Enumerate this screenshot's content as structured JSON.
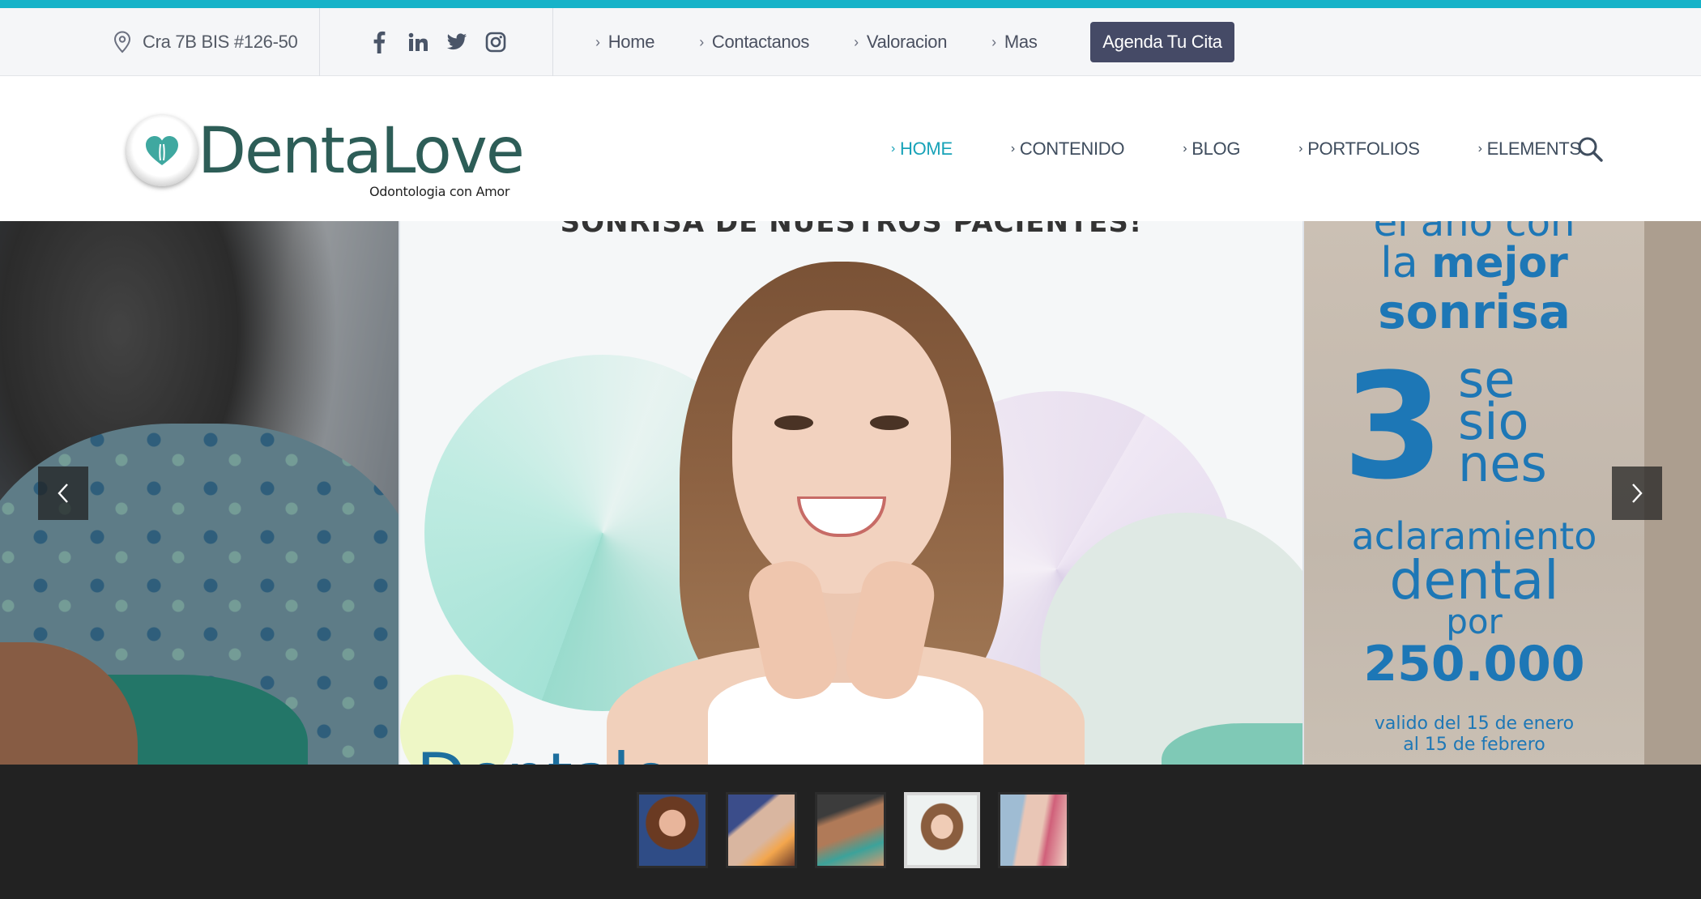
{
  "colors": {
    "accent": "#17a2b8",
    "cta_bg": "#454a66",
    "logo_green": "#2d5d57",
    "logo_heart": "#3fa8a0",
    "nav_text": "#3f4d5e",
    "thumb_bar": "#222222"
  },
  "topbar": {
    "address": "Cra 7B BIS #126-50",
    "social": [
      "facebook-icon",
      "linkedin-icon",
      "twitter-icon",
      "instagram-icon"
    ],
    "links": [
      {
        "label": "Home"
      },
      {
        "label": "Contactanos"
      },
      {
        "label": "Valoracion"
      },
      {
        "label": "Mas"
      }
    ],
    "cta_label": "Agenda Tu Cita"
  },
  "header": {
    "logo_word": "DentaLove",
    "logo_tagline": "Odontologia con Amor",
    "nav": [
      {
        "label": "HOME",
        "active": true
      },
      {
        "label": "CONTENIDO",
        "active": false
      },
      {
        "label": "BLOG",
        "active": false
      },
      {
        "label": "PORTFOLIOS",
        "active": false
      },
      {
        "label": "ELEMENTS",
        "active": false
      }
    ]
  },
  "slider": {
    "center_headline": "SONRISA DE NUESTROS PACIENTES!",
    "center_bottom_text": "Dentale",
    "right_promo": {
      "lines": [
        "el año con",
        "la",
        "mejor",
        "sonrisa"
      ],
      "number": "3",
      "sessions": [
        "se",
        "sio",
        "nes"
      ],
      "service": [
        "aclaramiento",
        "dental",
        "por"
      ],
      "price": "250.000",
      "validity": [
        "valido del 15 de enero",
        "al 15 de febrero"
      ]
    }
  },
  "thumbnails": {
    "count": 5,
    "active_index": 3
  }
}
